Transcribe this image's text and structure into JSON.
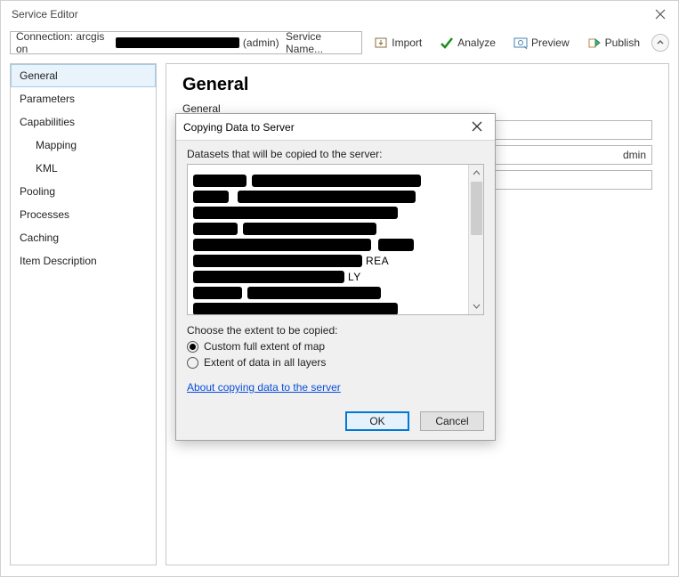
{
  "window": {
    "title": "Service Editor"
  },
  "toolbar": {
    "connection_prefix": "Connection: arcgis on",
    "connection_suffix": "(admin)",
    "service_name_label": "Service Name...",
    "import": "Import",
    "analyze": "Analyze",
    "preview": "Preview",
    "publish": "Publish"
  },
  "sidebar": {
    "items": [
      {
        "label": "General",
        "selected": true
      },
      {
        "label": "Parameters"
      },
      {
        "label": "Capabilities"
      },
      {
        "label": "Mapping",
        "sub": true
      },
      {
        "label": "KML",
        "sub": true
      },
      {
        "label": "Pooling"
      },
      {
        "label": "Processes"
      },
      {
        "label": "Caching"
      },
      {
        "label": "Item Description"
      }
    ]
  },
  "main": {
    "heading": "General",
    "section": "General",
    "field_suffix_visible": "dmin"
  },
  "dialog": {
    "title": "Copying Data to Server",
    "datasets_label": "Datasets that will be copied to the server:",
    "choose_label": "Choose the extent to be copied:",
    "radio1": "Custom full extent of map",
    "radio2": "Extent of data in all layers",
    "help_link": "About copying data to the server",
    "ok": "OK",
    "cancel": "Cancel",
    "row_tails": [
      "",
      "",
      "",
      "",
      "",
      "REA",
      "LY",
      "",
      ""
    ]
  }
}
